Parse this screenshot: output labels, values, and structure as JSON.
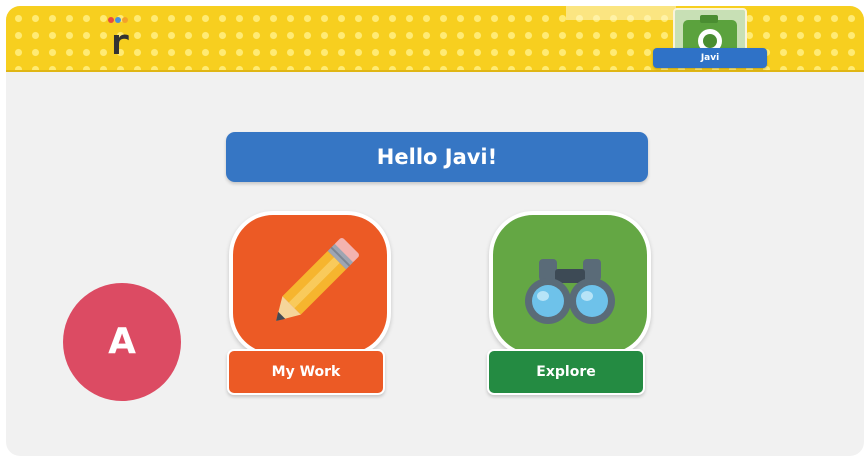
{
  "header": {
    "logo_letter": "r",
    "profile_name": "Javi",
    "brand_color": "#f7cf1f",
    "icons": [
      "app-logo-icon",
      "camera-avatar-icon"
    ]
  },
  "greeting": {
    "text": "Hello Javi!",
    "color": "#3676c4"
  },
  "tiles": [
    {
      "label": "My Work",
      "icon": "pencil-icon",
      "color": "#ec5a25"
    },
    {
      "label": "Explore",
      "icon": "binoculars-icon",
      "color": "#64a744",
      "label_color": "#248b42"
    }
  ],
  "badge": {
    "text": "A",
    "color": "#dc4b63"
  }
}
